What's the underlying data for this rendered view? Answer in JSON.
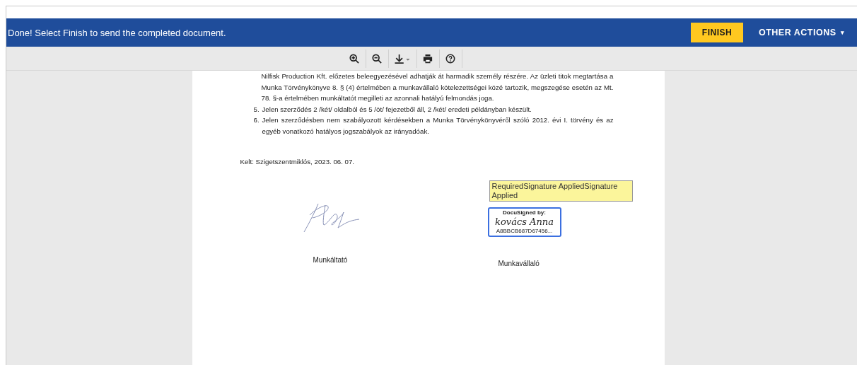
{
  "banner": {
    "message": "Done! Select Finish to send the completed document.",
    "finish_button": "FINISH",
    "other_actions": "OTHER ACTIONS",
    "other_actions_caret": "▾"
  },
  "document": {
    "continuation": "Nilfisk Production Kft. előzetes beleegyezésével adhatják át harmadik személy részére. Az üzleti titok megtartása a Munka Törvénykönyve 8. § (4) értelmében a munkavállaló kötelezettségei közé tartozik, megszegése esetén az Mt. 78. §-a értelmében munkáltatót megilleti az azonnali hatályú felmondás joga.",
    "items": [
      {
        "number": "5.",
        "text": "Jelen szerződés 2 /két/ oldalból és 5 /öt/ fejezetből áll, 2 /két/ eredeti példányban készült."
      },
      {
        "number": "6.",
        "text": "Jelen szerződésben nem szabályozott kérdésekben a Munka Törvénykönyvéről szóló 2012. évi I. törvény és az egyéb vonatkozó hatályos jogszabályok az irányadóak."
      }
    ],
    "date_line": "Kelt:  Szigetszentmiklós, 2023. 06. 07.",
    "signatures": [
      {
        "kind": "handwritten",
        "role": "Munkáltató"
      },
      {
        "kind": "docusign",
        "tag": "RequiredSignature AppliedSignature Applied",
        "header": "DocuSigned by:",
        "signer": "kovács Anna",
        "envelope_id": "A8BBCB687D67456...",
        "role": "Munkavállaló"
      }
    ]
  }
}
